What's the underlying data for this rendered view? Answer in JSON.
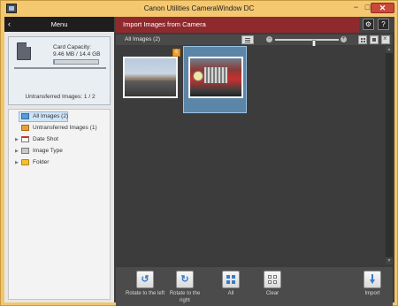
{
  "window": {
    "title": "Canon Utilities CameraWindow DC",
    "minimize": "−",
    "maximize": "□",
    "close": "✕"
  },
  "left_panel": {
    "menu_label": "Menu",
    "card_capacity_label": "Card Capacity:",
    "card_capacity_value": "9.46 MB / 14.4 GB",
    "card_capacity_used_fraction": 0.0007,
    "untransferred": "Untransferred Images: 1 / 2",
    "tree": [
      {
        "label": "All Images (2)",
        "selected": true,
        "icon": "all-images-icon"
      },
      {
        "label": "Untransferred Images (1)",
        "selected": false,
        "icon": "untransferred-icon"
      },
      {
        "label": "Date Shot",
        "selected": false,
        "icon": "calendar-icon"
      },
      {
        "label": "Image Type",
        "selected": false,
        "icon": "image-type-icon"
      },
      {
        "label": "Folder",
        "selected": false,
        "icon": "folder-icon"
      }
    ]
  },
  "right_panel": {
    "header_title": "Import Images from Camera",
    "settings_icon": "gear-icon",
    "help_label": "?",
    "view_label": "All Images (2)",
    "zoom_level_fraction": 0.62,
    "thumbnails": [
      {
        "name": "road-landscape",
        "untransferred": true,
        "selected": false
      },
      {
        "name": "red-truck",
        "untransferred": false,
        "selected": true
      }
    ],
    "untransferred_badge": "⇩",
    "actions": {
      "rotate_left": "Rotate to the left",
      "rotate_right": "Rotate to the right",
      "all": "All",
      "clear": "Clear",
      "import": "Import"
    }
  },
  "colors": {
    "window_frame": "#f4c870",
    "header_accent": "#8e2a2e",
    "selection": "#5b86a8",
    "badge": "#f0a12d"
  }
}
